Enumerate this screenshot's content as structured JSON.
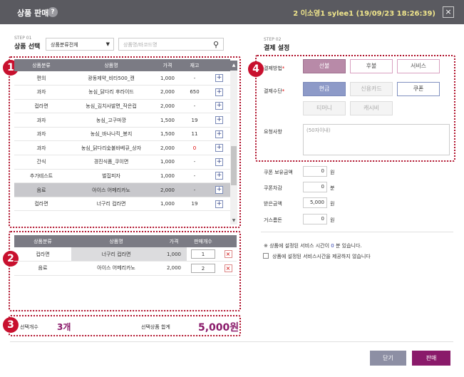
{
  "window": {
    "title": "상품 판매",
    "help_icon": "?",
    "user_info": "2 이소영1 sylee1 (19/09/23 18:26:39)",
    "close_icon": "×"
  },
  "left": {
    "step_label": "STEP 01",
    "step_title": "상품 선택",
    "category_select": "상품분류전체",
    "search_placeholder": "상품명/바코드명",
    "badge1": "1",
    "badge2": "2",
    "badge3": "3",
    "product_table": {
      "headers": [
        "상품분류",
        "상품명",
        "가격",
        "재고",
        ""
      ],
      "rows": [
        {
          "category": "편의",
          "name": "광동제약_비타500_캔",
          "price": "1,000",
          "stock": "-"
        },
        {
          "category": "과자",
          "name": "농심_닭다리 후라이드",
          "price": "2,000",
          "stock": "650"
        },
        {
          "category": "컵라면",
          "name": "농심_김치사발면_작은컵",
          "price": "2,000",
          "stock": "-"
        },
        {
          "category": "과자",
          "name": "농심_고구마깡",
          "price": "1,500",
          "stock": "19"
        },
        {
          "category": "과자",
          "name": "농심_바나나킥_봉지",
          "price": "1,500",
          "stock": "11"
        },
        {
          "category": "과자",
          "name": "농심_닭다리숯불바베큐_상자",
          "price": "2,000",
          "stock": "0"
        },
        {
          "category": "간식",
          "name": "경진식품_쿠이면",
          "price": "1,000",
          "stock": "-"
        },
        {
          "category": "추가테스트",
          "name": "벌집피자",
          "price": "1,000",
          "stock": "-"
        },
        {
          "category": "음료",
          "name": "아이스 어메리카노",
          "price": "2,000",
          "stock": "-"
        },
        {
          "category": "컵라면",
          "name": "너구리 컵라면",
          "price": "1,000",
          "stock": "19"
        }
      ]
    },
    "selected_table": {
      "headers": [
        "상품분류",
        "상품명",
        "가격",
        "판매개수",
        ""
      ],
      "rows": [
        {
          "category": "컵라면",
          "name": "너구리 컵라면",
          "price": "1,000",
          "qty": "1"
        },
        {
          "category": "음료",
          "name": "아이스 어메리카노",
          "price": "2,000",
          "qty": "2"
        }
      ]
    },
    "summary": {
      "count_label": "선택개수",
      "count_value": "3개",
      "total_label": "선택상품 합계",
      "total_value": "5,000원"
    }
  },
  "right": {
    "step_label": "STEP 02",
    "step_title": "결제 설정",
    "badge4": "4",
    "pay_method_label": "결제방법",
    "pay_methods": [
      "선불",
      "후불",
      "서비스"
    ],
    "pay_means_label": "결제수단",
    "pay_means": [
      "현금",
      "신용카드",
      "쿠폰",
      "티머니",
      "캐시비"
    ],
    "request_label": "요청사항",
    "request_placeholder": "(50자이내)",
    "coupon_balance_label": "쿠폰 보유금액",
    "coupon_balance_value": "0",
    "coupon_balance_unit": "원",
    "coupon_deduct_label": "쿠폰차감",
    "coupon_deduct_value": "0",
    "coupon_deduct_unit": "분",
    "received_label": "받은금액",
    "received_value": "5,000",
    "received_unit": "원",
    "change_label": "거스름돈",
    "change_value": "0",
    "change_unit": "원",
    "info_text_a": "※ 상품에 설정된 서비스 시간이 ",
    "info_text_num": "0",
    "info_text_b": " 분 있습니다.",
    "checkbox_label": "상품에 설정된 서비스시간을 제공하지 않습니다"
  },
  "footer": {
    "close_label": "닫기",
    "sell_label": "판매"
  },
  "colors": {
    "accent": "#8a1a6a",
    "badge": "#c8102e",
    "titlebar": "#5a5a60"
  }
}
